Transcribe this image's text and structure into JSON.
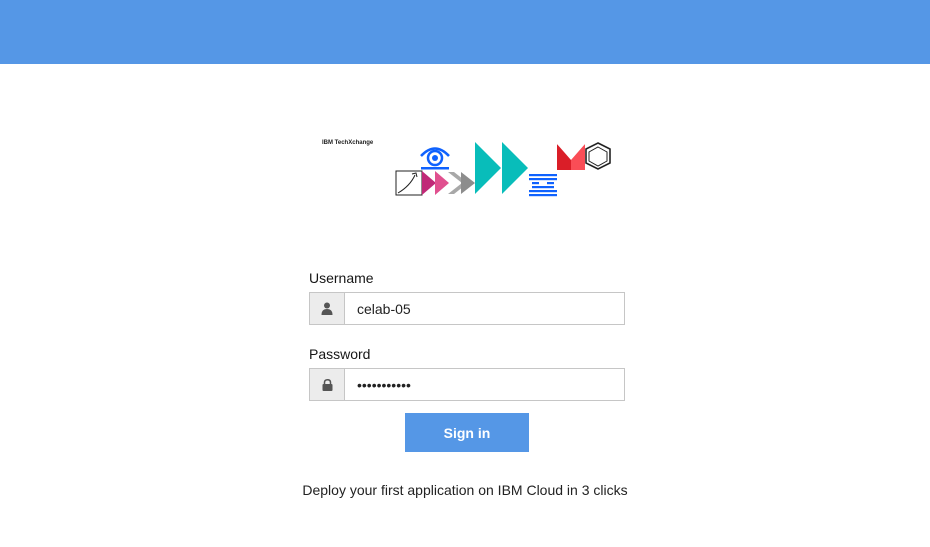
{
  "brand": {
    "text": "IBM TechXchange",
    "accent_color": "#5597e6"
  },
  "form": {
    "username_label": "Username",
    "username_value": "celab-05",
    "password_label": "Password",
    "password_value": "•••••••••••",
    "signin_label": "Sign in"
  },
  "footer": {
    "text": "Deploy your first application on IBM Cloud in 3 clicks"
  },
  "icons": {
    "username": "user-icon",
    "password": "lock-icon"
  }
}
